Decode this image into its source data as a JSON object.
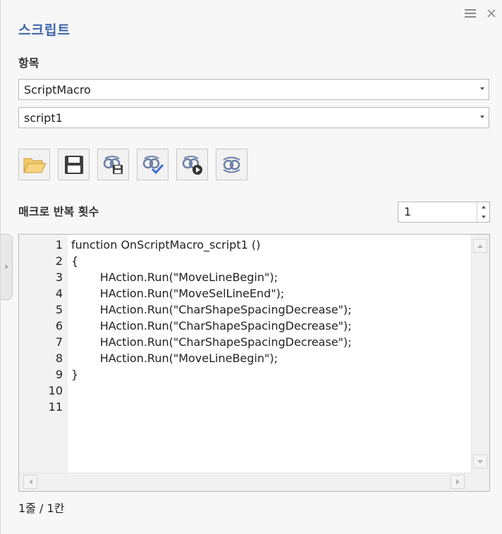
{
  "panel": {
    "title": "스크립트",
    "menu_icon": "hamburger-menu-icon",
    "close_icon": "close-icon",
    "collapse_icon": "chevron-right-icon"
  },
  "items": {
    "label": "항목",
    "macro_select": {
      "value": "ScriptMacro"
    },
    "script_select": {
      "value": "script1"
    }
  },
  "toolbar": {
    "buttons": [
      {
        "name": "open-script-button",
        "icon": "folder-open-icon"
      },
      {
        "name": "save-script-button",
        "icon": "save-disk-icon"
      },
      {
        "name": "save-macro-button",
        "icon": "macro-save-icon"
      },
      {
        "name": "define-macro-button",
        "icon": "macro-check-icon"
      },
      {
        "name": "run-macro-button",
        "icon": "macro-play-icon"
      },
      {
        "name": "repeat-macro-button",
        "icon": "macro-loop-icon"
      }
    ]
  },
  "repeat": {
    "label": "매크로 반복 횟수",
    "value": "1"
  },
  "editor": {
    "line_numbers": [
      "1",
      "2",
      "3",
      "4",
      "5",
      "6",
      "7",
      "8",
      "9",
      "10",
      "11"
    ],
    "lines": [
      "function OnScriptMacro_script1 ()",
      "{",
      "\t\tHAction.Run(\"MoveLineBegin\");",
      "\t\tHAction.Run(\"MoveSelLineEnd\");",
      "\t\tHAction.Run(\"CharShapeSpacingDecrease\");",
      "\t\tHAction.Run(\"CharShapeSpacingDecrease\");",
      "\t\tHAction.Run(\"CharShapeSpacingDecrease\");",
      "\t\tHAction.Run(\"MoveLineBegin\");",
      "}",
      "",
      ""
    ]
  },
  "status": {
    "position": "1줄 / 1칸"
  },
  "colors": {
    "title": "#3e64a8",
    "panel_bg": "#f7f7f7",
    "gutter_bg": "#f2f2f2"
  }
}
